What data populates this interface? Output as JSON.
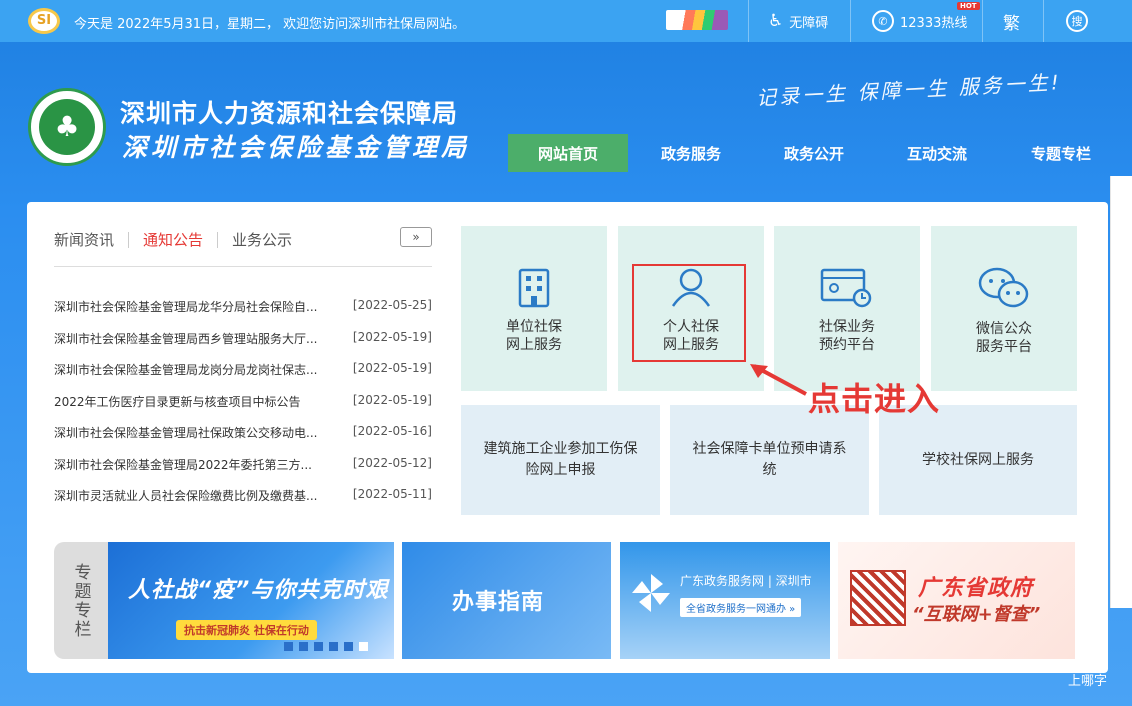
{
  "topbar": {
    "logo": "SI",
    "date_text": "今天是 2022年5月31日，星期二， 欢迎您访问深圳市社保局网站。",
    "accessibility": "无障碍",
    "hotline": "12333热线",
    "hot_badge": "HOT",
    "traditional": "繁",
    "search": "搜"
  },
  "header": {
    "emblem_glyph": "♣",
    "title_line1": "深圳市人力资源和社会保障局",
    "title_line2": "深圳市社会保险基金管理局",
    "slogan": "记录一生 保障一生 服务一生!"
  },
  "nav": [
    {
      "label": "网站首页",
      "active": true
    },
    {
      "label": "政务服务",
      "active": false
    },
    {
      "label": "政务公开",
      "active": false
    },
    {
      "label": "互动交流",
      "active": false
    },
    {
      "label": "专题专栏",
      "active": false
    }
  ],
  "news_tabs": [
    {
      "label": "新闻资讯",
      "active": false
    },
    {
      "label": "通知公告",
      "active": true
    },
    {
      "label": "业务公示",
      "active": false
    }
  ],
  "more_button": "»",
  "news": [
    {
      "title": "深圳市社会保险基金管理局龙华分局社会保险自...",
      "date": "[2022-05-25]"
    },
    {
      "title": "深圳市社会保险基金管理局西乡管理站服务大厅...",
      "date": "[2022-05-19]"
    },
    {
      "title": "深圳市社会保险基金管理局龙岗分局龙岗社保志...",
      "date": "[2022-05-19]"
    },
    {
      "title": "2022年工伤医疗目录更新与核查项目中标公告",
      "date": "[2022-05-19]"
    },
    {
      "title": "深圳市社会保险基金管理局社保政策公交移动电...",
      "date": "[2022-05-16]"
    },
    {
      "title": "深圳市社会保险基金管理局2022年委托第三方...",
      "date": "[2022-05-12]"
    },
    {
      "title": "深圳市灵活就业人员社会保险缴费比例及缴费基...",
      "date": "[2022-05-11]"
    }
  ],
  "services_top": [
    {
      "line1": "单位社保",
      "line2": "网上服务",
      "icon": "building-icon"
    },
    {
      "line1": "个人社保",
      "line2": "网上服务",
      "icon": "person-icon"
    },
    {
      "line1": "社保业务",
      "line2": "预约平台",
      "icon": "appointment-icon"
    },
    {
      "line1": "微信公众",
      "line2": "服务平台",
      "icon": "wechat-icon"
    }
  ],
  "services_bottom": [
    {
      "label": "建筑施工企业参加工伤保险网上申报"
    },
    {
      "label": "社会保障卡单位预申请系统"
    },
    {
      "label": "学校社保网上服务"
    }
  ],
  "annotation": {
    "text": "点击进入",
    "color": "#e53935"
  },
  "special": {
    "label": "专题专栏",
    "banner1_title": "人社战“疫”与你共克时艰",
    "banner1_sub": "抗击新冠肺炎 社保在行动",
    "banner2_title": "办事指南",
    "banner3_title": "广东政务服务网 | 深圳市",
    "banner3_sub": "全省政务服务一网通办 »",
    "banner4_title": "广东省政府",
    "banner4_sub": "“互联网+督查”"
  },
  "corner_text": "上哪字",
  "colors": {
    "brand_blue": "#3ba3f2",
    "nav_active": "#4cae6a",
    "accent_red": "#e53935",
    "tile_green": "#dff2ee"
  }
}
